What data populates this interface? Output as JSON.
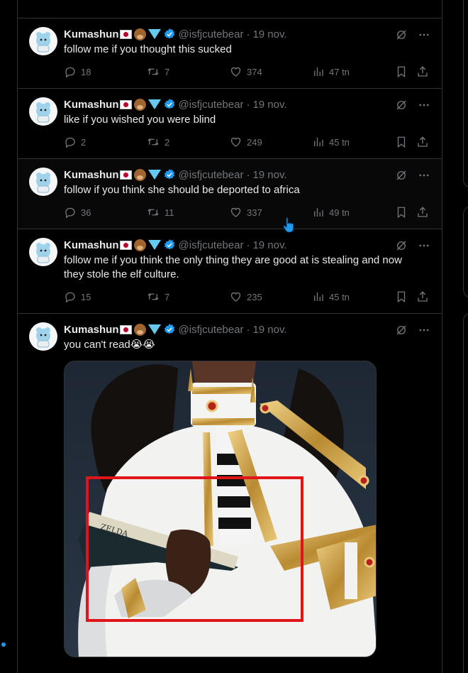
{
  "tweets": [
    {
      "name": "Kumashun",
      "handle": "@isfjcutebear",
      "date": "19 nov.",
      "text": "follow me if you thought this sucked",
      "replies": "18",
      "retweets": "7",
      "likes": "374",
      "views": "47 tn"
    },
    {
      "name": "Kumashun",
      "handle": "@isfjcutebear",
      "date": "19 nov.",
      "text": "like if you wished you were blind",
      "replies": "2",
      "retweets": "2",
      "likes": "249",
      "views": "45 tn"
    },
    {
      "name": "Kumashun",
      "handle": "@isfjcutebear",
      "date": "19 nov.",
      "text": "follow if you think she should be deported to africa",
      "replies": "36",
      "retweets": "11",
      "likes": "337",
      "views": "49 tn"
    },
    {
      "name": "Kumashun",
      "handle": "@isfjcutebear",
      "date": "19 nov.",
      "text": "follow me if you think the only thing they are good at is stealing and now they stole the elf culture.",
      "replies": "15",
      "retweets": "7",
      "likes": "235",
      "views": "45 tn"
    },
    {
      "name": "Kumashun",
      "handle": "@isfjcutebear",
      "date": "19 nov.",
      "text": "you can't read😭😭"
    }
  ],
  "dot_separator": "·",
  "colors": {
    "background": "#000000",
    "border": "#2f3336",
    "text_primary": "#e7e9ea",
    "text_secondary": "#71767b",
    "verified_blue": "#1d9bf0",
    "highlight_red": "#e1141a"
  },
  "icons": [
    "grok-icon",
    "more-icon",
    "reply-icon",
    "retweet-icon",
    "like-icon",
    "views-icon",
    "bookmark-icon",
    "share-icon",
    "verified-badge-icon"
  ]
}
